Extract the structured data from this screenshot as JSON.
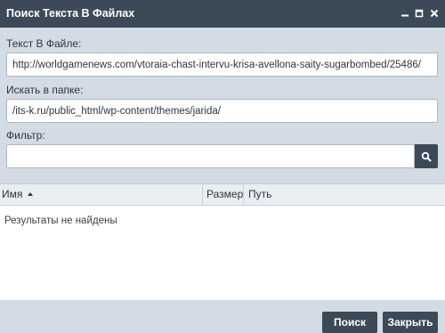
{
  "window": {
    "title": "Поиск Текста В Файлах",
    "icons": {
      "minimize": "minimize-icon",
      "maximize": "maximize-icon",
      "close": "close-icon"
    }
  },
  "form": {
    "text_label": "Текст В Файле:",
    "text_value": "http://worldgamenews.com/vtoraia-chast-intervu-krisa-avellona-saity-sugarbombed/25486/",
    "folder_label": "Искать в папке:",
    "folder_value": "/its-k.ru/public_html/wp-content/themes/jarida/",
    "filter_label": "Фильтр:",
    "filter_value": "",
    "search_icon": "magnifier-icon"
  },
  "results": {
    "columns": {
      "name": "Имя",
      "size": "Размер",
      "path": "Путь"
    },
    "sort": {
      "column": "name",
      "direction": "ascending"
    },
    "empty_message": "Результаты не найдены"
  },
  "footer": {
    "search_label": "Поиск",
    "close_label": "Закрыть"
  },
  "colors": {
    "titlebar": "#3c4a57",
    "panel": "#d3dbe4",
    "button": "#3c4a57",
    "button_text": "#ffffff"
  }
}
